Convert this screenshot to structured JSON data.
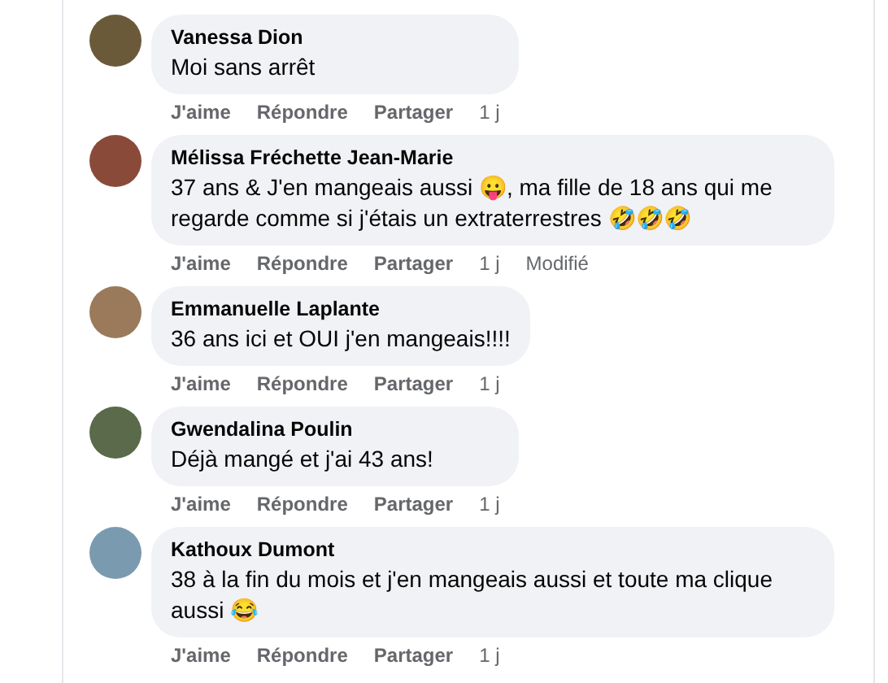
{
  "comments": [
    {
      "author": "Vanessa Dion",
      "text": "Moi sans arrêt",
      "actions": [
        "J'aime",
        "Répondre",
        "Partager",
        "1 j"
      ]
    },
    {
      "author": "Mélissa Fréchette Jean-Marie",
      "text": "37 ans & J'en mangeais aussi 😛, ma fille de 18 ans qui me regarde comme si j'étais un extraterrestres 🤣🤣🤣",
      "actions": [
        "J'aime",
        "Répondre",
        "Partager",
        "1 j",
        "Modifié"
      ]
    },
    {
      "author": "Emmanuelle Laplante",
      "text": "36 ans ici et OUI j'en mangeais!!!!",
      "actions": [
        "J'aime",
        "Répondre",
        "Partager",
        "1 j"
      ]
    },
    {
      "author": "Gwendalina Poulin",
      "text": "Déjà mangé et j'ai 43 ans!",
      "actions": [
        "J'aime",
        "Répondre",
        "Partager",
        "1 j"
      ]
    },
    {
      "author": "Kathoux Dumont",
      "text": "38 à la fin du mois et j'en mangeais aussi et toute ma clique aussi 😂",
      "actions": [
        "J'aime",
        "Répondre",
        "Partager",
        "1 j"
      ]
    }
  ]
}
